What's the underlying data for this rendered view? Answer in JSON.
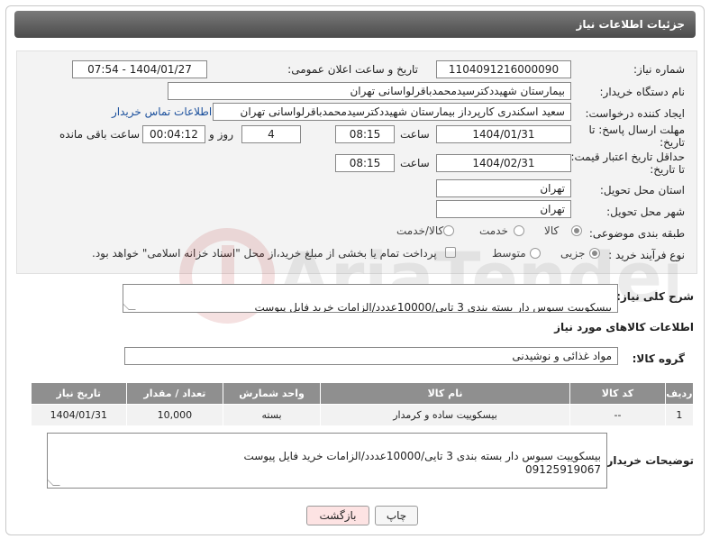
{
  "header": {
    "title": "جزئیات اطلاعات نیاز"
  },
  "form": {
    "need_number": {
      "label": "شماره نیاز:",
      "value": "1104091216000090"
    },
    "announce": {
      "label": "تاریخ و ساعت اعلان عمومی:",
      "value": "1404/01/27 - 07:54"
    },
    "buyer_org": {
      "label": "نام دستگاه خریدار:",
      "value": "بیمارستان شهیددکترسیدمحمدباقرلواسانی تهران"
    },
    "requester": {
      "label": "ایجاد کننده درخواست:",
      "value": "سعید اسکندری کارپرداز بیمارستان شهیددکترسیدمحمدباقرلواسانی تهران",
      "contact_link": "اطلاعات تماس خریدار"
    },
    "reply_deadline": {
      "label_line1": "مهلت ارسال پاسخ: تا",
      "label_line2": "تاریخ:",
      "date": "1404/01/31",
      "time_label": "ساعت",
      "time": "08:15",
      "days": "4",
      "days_label": "روز و",
      "remaining": "00:04:12",
      "remaining_label": "ساعت باقی مانده"
    },
    "price_deadline": {
      "label_line1": "حداقل تاریخ اعتبار قیمت:",
      "label_line2": "تا تاریخ:",
      "date": "1404/02/31",
      "time_label": "ساعت",
      "time": "08:15"
    },
    "province": {
      "label": "استان محل تحویل:",
      "value": "تهران"
    },
    "city": {
      "label": "شهر محل تحویل:",
      "value": "تهران"
    },
    "category": {
      "label": "طبقه بندی موضوعی:",
      "options": [
        "کالا",
        "خدمت",
        "کالا/خدمت"
      ],
      "selected": "کالا"
    },
    "purchase_type": {
      "label": "نوع فرآیند خرید :",
      "options": [
        "جزیی",
        "متوسط"
      ],
      "selected": "جزیی",
      "note": "پرداخت تمام یا بخشی از مبلغ خرید،از محل \"اسناد خزانه اسلامی\" خواهد بود."
    }
  },
  "description": {
    "label": "شرح کلی نیاز:",
    "value": "بیسکوییت سبوس دار بسته بندی 3 تایی/10000عددد/الزامات خرید فایل پیوست"
  },
  "goods": {
    "section_title": "اطلاعات کالاهای مورد نیاز",
    "group_label": "گروه کالا:",
    "group_value": "مواد غذائی و نوشیدنی",
    "columns": [
      "ردیف",
      "کد کالا",
      "نام کالا",
      "واحد شمارش",
      "تعداد / مقدار",
      "تاریخ نیاز"
    ],
    "rows": [
      {
        "row": "1",
        "code": "--",
        "name": "بیسکوییت ساده و کرمدار",
        "unit": "بسته",
        "qty": "10,000",
        "date": "1404/01/31"
      }
    ]
  },
  "buyer_notes": {
    "label": "توضیحات خریدار:",
    "value": "بیسکوییت سبوس دار بسته بندی 3 تایی/10000عددد/الزامات خرید فایل پیوست\n09125919067"
  },
  "buttons": {
    "print": "چاپ",
    "back": "بازگشت"
  },
  "watermark": {
    "text": "AriaTender.net"
  },
  "colors": {
    "header_bg": "#5a5a5a",
    "table_header": "#8f8f8f",
    "link": "#1a4f9c",
    "back_button_bg": "#fde3e3"
  }
}
